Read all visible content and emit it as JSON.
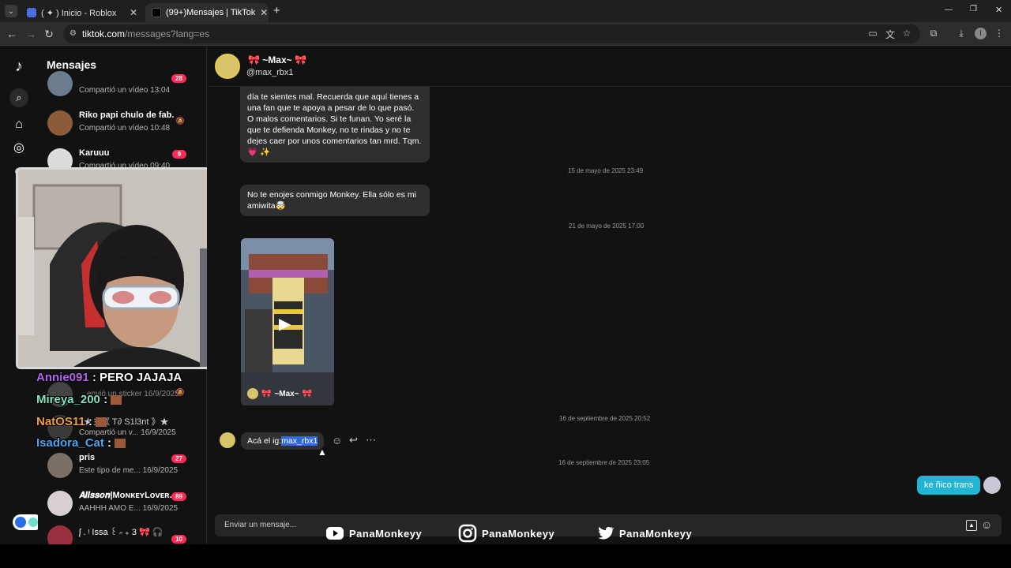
{
  "browser": {
    "tabs": [
      {
        "label": "( ✦ ) Inicio - Roblox",
        "close": "✕"
      },
      {
        "label": "(99+)Mensajes | TikTok",
        "close": "✕"
      }
    ],
    "new_tab": "+",
    "window_controls": {
      "minimize": "—",
      "restore": "❐",
      "close": "✕"
    },
    "url_domain": "tiktok.com",
    "url_path": "/messages?lang=es",
    "profile_initial": "I"
  },
  "sidebar": {
    "title": "Mensajes",
    "conversations": [
      {
        "preview": "Compartió un vídeo",
        "time": "13:04",
        "badge": "28"
      },
      {
        "name": "Riko papi chulo de fab...",
        "preview": "Compartió un vídeo",
        "time": "10:48"
      },
      {
        "name": "Karuuu",
        "preview": "Compartió un vídeo",
        "time": "09:40",
        "badge": "9"
      },
      {
        "preview": "envió un sticker",
        "time": "16/9/2025"
      },
      {
        "name": "★彡《 T∂ S1l3nt 》★",
        "preview": "Compartió un v...",
        "time": "16/9/2025"
      },
      {
        "name": "pris",
        "preview": "Este tipo de me...",
        "time": "16/9/2025",
        "badge": "27"
      },
      {
        "name": "𝑨𝒍𝒊𝒔𝒔𝒐𝒏|MᴏɴᴋᴇʏLᴏᴠᴇʀ...",
        "preview": "AAHHH AMO E...",
        "time": "16/9/2025",
        "badge": "89"
      },
      {
        "name": "ᶘ . ᵎ Issa ꒰ ˶ ₊ 3 🎀 🎧",
        "badge": "10"
      }
    ]
  },
  "stream_chat": [
    {
      "user": "Annie091",
      "sep": " : ",
      "msg": "PERO JAJAJA",
      "color": "#b565f0"
    },
    {
      "user": "Mireya_200",
      "sep": " : ",
      "msg": "",
      "color": "#7fe6c8"
    },
    {
      "user": "NatOS11",
      "sep": " : ",
      "msg": "",
      "color": "#f0a030"
    },
    {
      "user": "Isadora_Cat",
      "sep": " : ",
      "msg": "",
      "color": "#4aa8f0"
    }
  ],
  "chat": {
    "contact_name": "~Max~",
    "contact_handle": "@max_rbx1",
    "message1": "día te sientes mal. Recuerda que aquí tienes a una fan que te apoya a pesar de lo que pasó. O malos comentarios. Si te funan. Yo seré la que te defienda Monkey, no te rindas y no te dejes caer por unos comentarios tan mrd. Tqm. 💗 ✨",
    "timestamp1": "15 de mayo de 2025 23:49",
    "message2": "No te enojes conmigo Monkey. Ella sólo es mi amiwita🤯",
    "timestamp2": "21 de mayo de 2025 17:00",
    "video_author": "~Max~",
    "timestamp3": "16 de septiembre de 2025 20:52",
    "message3_prefix": "Acá el ig:",
    "message3_highlight": "max_rbx1",
    "timestamp4": "16 de septiembre de 2025 23:05",
    "sent_message": "ke ñico trans",
    "input_placeholder": "Enviar un mensaje..."
  },
  "overlay_socials": [
    {
      "platform": "youtube-icon",
      "handle": "PanaMonkeyy"
    },
    {
      "platform": "instagram-icon",
      "handle": "PanaMonkeyy"
    },
    {
      "platform": "twitter-icon",
      "handle": "PanaMonkeyy"
    }
  ],
  "colors": {
    "accent": "#fe2c55",
    "sent_bubble": "#20b5d2",
    "highlight": "#2f6bd8"
  }
}
